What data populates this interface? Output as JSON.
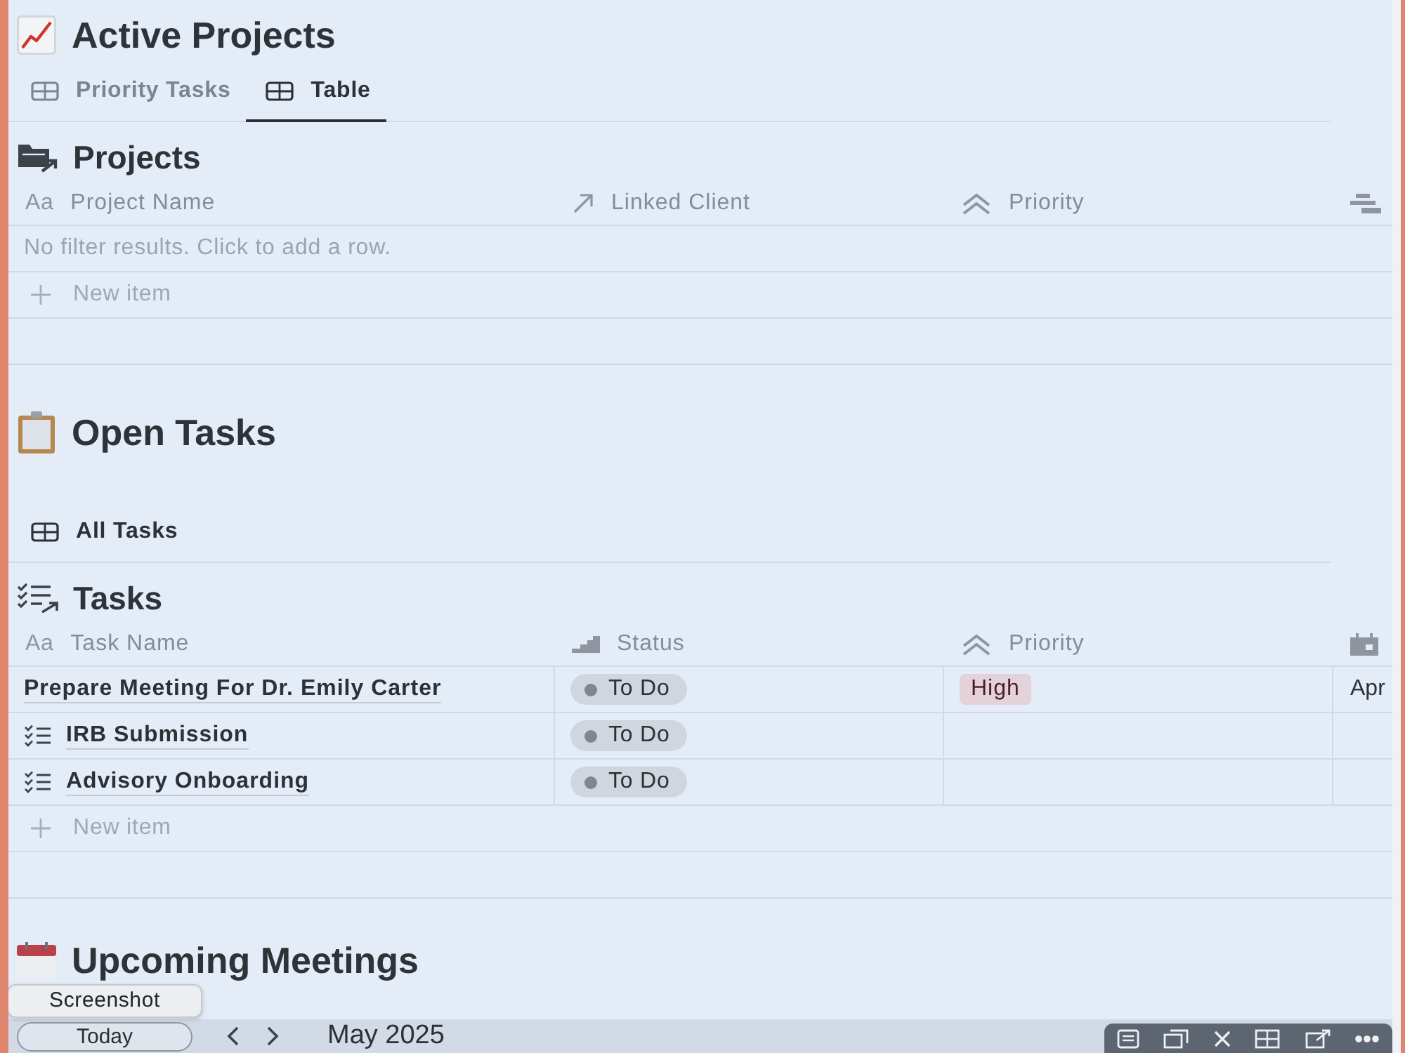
{
  "page": {
    "title": "Active Projects"
  },
  "tabs": [
    {
      "label": "Priority Tasks",
      "selected": false
    },
    {
      "label": "Table",
      "selected": true
    }
  ],
  "projects": {
    "title": "Projects",
    "columns": [
      {
        "label": "Project Name",
        "kind": "title",
        "glyph": "Aa"
      },
      {
        "label": "Linked Client",
        "kind": "relation"
      },
      {
        "label": "Priority",
        "kind": "select"
      },
      {
        "kind": "timeline"
      }
    ],
    "empty_message": "No filter results. Click to add a row.",
    "new_item": "New item"
  },
  "open_tasks": {
    "title": "Open Tasks",
    "views": [
      {
        "label": "All Tasks",
        "selected": true
      }
    ]
  },
  "tasks": {
    "title": "Tasks",
    "columns": [
      {
        "label": "Task Name",
        "kind": "title",
        "glyph": "Aa"
      },
      {
        "label": "Status",
        "kind": "status"
      },
      {
        "label": "Priority",
        "kind": "select"
      },
      {
        "kind": "date"
      }
    ],
    "rows": [
      {
        "name": "Prepare Meeting For Dr. Emily Carter",
        "kind": "page",
        "status": "To Do",
        "priority": "High",
        "date": "Apr"
      },
      {
        "name": "IRB Submission",
        "kind": "checklist",
        "status": "To Do"
      },
      {
        "name": "Advisory Onboarding",
        "kind": "checklist",
        "status": "To Do"
      }
    ],
    "new_item": "New item"
  },
  "meetings": {
    "title": "Upcoming Meetings"
  },
  "tooltip": {
    "text": "Screenshot"
  },
  "calendar_bar": {
    "today_button": "Today",
    "month": "May 2025"
  }
}
